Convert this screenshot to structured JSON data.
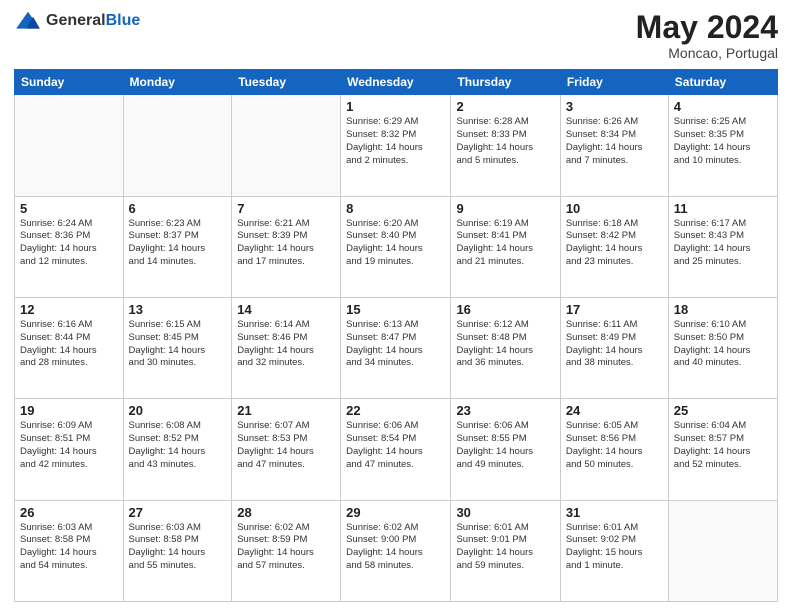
{
  "header": {
    "logo_general": "General",
    "logo_blue": "Blue",
    "month": "May 2024",
    "location": "Moncao, Portugal"
  },
  "days_of_week": [
    "Sunday",
    "Monday",
    "Tuesday",
    "Wednesday",
    "Thursday",
    "Friday",
    "Saturday"
  ],
  "weeks": [
    [
      {
        "day": "",
        "text": ""
      },
      {
        "day": "",
        "text": ""
      },
      {
        "day": "",
        "text": ""
      },
      {
        "day": "1",
        "text": "Sunrise: 6:29 AM\nSunset: 8:32 PM\nDaylight: 14 hours\nand 2 minutes."
      },
      {
        "day": "2",
        "text": "Sunrise: 6:28 AM\nSunset: 8:33 PM\nDaylight: 14 hours\nand 5 minutes."
      },
      {
        "day": "3",
        "text": "Sunrise: 6:26 AM\nSunset: 8:34 PM\nDaylight: 14 hours\nand 7 minutes."
      },
      {
        "day": "4",
        "text": "Sunrise: 6:25 AM\nSunset: 8:35 PM\nDaylight: 14 hours\nand 10 minutes."
      }
    ],
    [
      {
        "day": "5",
        "text": "Sunrise: 6:24 AM\nSunset: 8:36 PM\nDaylight: 14 hours\nand 12 minutes."
      },
      {
        "day": "6",
        "text": "Sunrise: 6:23 AM\nSunset: 8:37 PM\nDaylight: 14 hours\nand 14 minutes."
      },
      {
        "day": "7",
        "text": "Sunrise: 6:21 AM\nSunset: 8:39 PM\nDaylight: 14 hours\nand 17 minutes."
      },
      {
        "day": "8",
        "text": "Sunrise: 6:20 AM\nSunset: 8:40 PM\nDaylight: 14 hours\nand 19 minutes."
      },
      {
        "day": "9",
        "text": "Sunrise: 6:19 AM\nSunset: 8:41 PM\nDaylight: 14 hours\nand 21 minutes."
      },
      {
        "day": "10",
        "text": "Sunrise: 6:18 AM\nSunset: 8:42 PM\nDaylight: 14 hours\nand 23 minutes."
      },
      {
        "day": "11",
        "text": "Sunrise: 6:17 AM\nSunset: 8:43 PM\nDaylight: 14 hours\nand 25 minutes."
      }
    ],
    [
      {
        "day": "12",
        "text": "Sunrise: 6:16 AM\nSunset: 8:44 PM\nDaylight: 14 hours\nand 28 minutes."
      },
      {
        "day": "13",
        "text": "Sunrise: 6:15 AM\nSunset: 8:45 PM\nDaylight: 14 hours\nand 30 minutes."
      },
      {
        "day": "14",
        "text": "Sunrise: 6:14 AM\nSunset: 8:46 PM\nDaylight: 14 hours\nand 32 minutes."
      },
      {
        "day": "15",
        "text": "Sunrise: 6:13 AM\nSunset: 8:47 PM\nDaylight: 14 hours\nand 34 minutes."
      },
      {
        "day": "16",
        "text": "Sunrise: 6:12 AM\nSunset: 8:48 PM\nDaylight: 14 hours\nand 36 minutes."
      },
      {
        "day": "17",
        "text": "Sunrise: 6:11 AM\nSunset: 8:49 PM\nDaylight: 14 hours\nand 38 minutes."
      },
      {
        "day": "18",
        "text": "Sunrise: 6:10 AM\nSunset: 8:50 PM\nDaylight: 14 hours\nand 40 minutes."
      }
    ],
    [
      {
        "day": "19",
        "text": "Sunrise: 6:09 AM\nSunset: 8:51 PM\nDaylight: 14 hours\nand 42 minutes."
      },
      {
        "day": "20",
        "text": "Sunrise: 6:08 AM\nSunset: 8:52 PM\nDaylight: 14 hours\nand 43 minutes."
      },
      {
        "day": "21",
        "text": "Sunrise: 6:07 AM\nSunset: 8:53 PM\nDaylight: 14 hours\nand 47 minutes."
      },
      {
        "day": "22",
        "text": "Sunrise: 6:06 AM\nSunset: 8:54 PM\nDaylight: 14 hours\nand 47 minutes."
      },
      {
        "day": "23",
        "text": "Sunrise: 6:06 AM\nSunset: 8:55 PM\nDaylight: 14 hours\nand 49 minutes."
      },
      {
        "day": "24",
        "text": "Sunrise: 6:05 AM\nSunset: 8:56 PM\nDaylight: 14 hours\nand 50 minutes."
      },
      {
        "day": "25",
        "text": "Sunrise: 6:04 AM\nSunset: 8:57 PM\nDaylight: 14 hours\nand 52 minutes."
      }
    ],
    [
      {
        "day": "26",
        "text": "Sunrise: 6:03 AM\nSunset: 8:58 PM\nDaylight: 14 hours\nand 54 minutes."
      },
      {
        "day": "27",
        "text": "Sunrise: 6:03 AM\nSunset: 8:58 PM\nDaylight: 14 hours\nand 55 minutes."
      },
      {
        "day": "28",
        "text": "Sunrise: 6:02 AM\nSunset: 8:59 PM\nDaylight: 14 hours\nand 57 minutes."
      },
      {
        "day": "29",
        "text": "Sunrise: 6:02 AM\nSunset: 9:00 PM\nDaylight: 14 hours\nand 58 minutes."
      },
      {
        "day": "30",
        "text": "Sunrise: 6:01 AM\nSunset: 9:01 PM\nDaylight: 14 hours\nand 59 minutes."
      },
      {
        "day": "31",
        "text": "Sunrise: 6:01 AM\nSunset: 9:02 PM\nDaylight: 15 hours\nand 1 minute."
      },
      {
        "day": "",
        "text": ""
      }
    ]
  ]
}
